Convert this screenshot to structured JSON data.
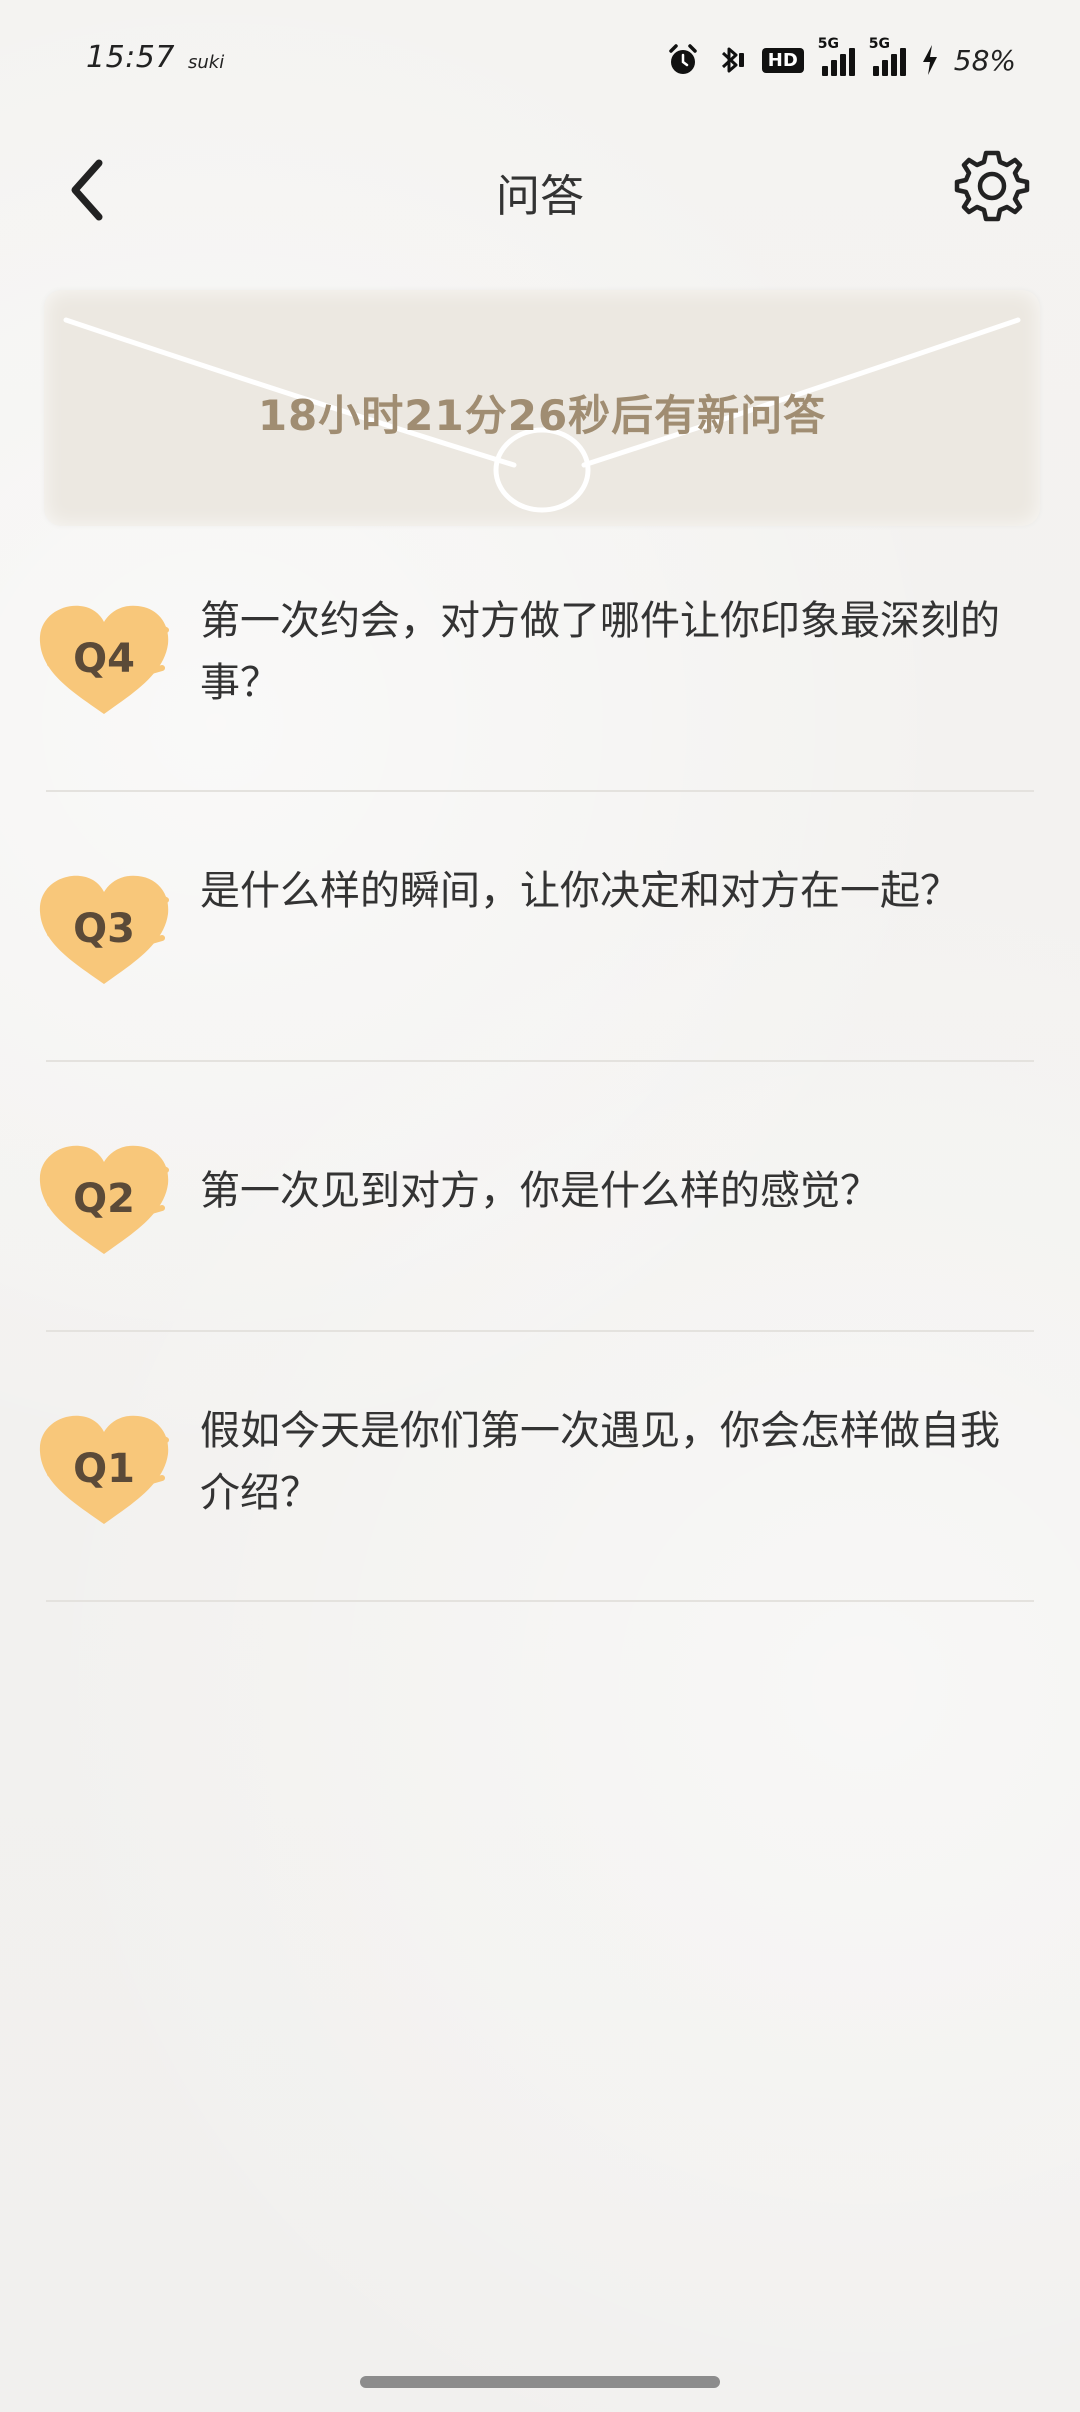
{
  "status_bar": {
    "time": "15:57",
    "carrier_note": "suki",
    "hd_label": "HD",
    "network1": "5G",
    "network2": "5G",
    "battery": "58%"
  },
  "header": {
    "title": "问答",
    "back_icon": "chevron-left-icon",
    "settings_icon": "gear-icon"
  },
  "envelope": {
    "countdown": "18小时21分26秒后有新问答"
  },
  "questions": [
    {
      "label": "Q4",
      "text": "第一次约会，对方做了哪件让你印象最深刻的事？"
    },
    {
      "label": "Q3",
      "text": "是什么样的瞬间，让你决定和对方在一起？"
    },
    {
      "label": "Q2",
      "text": "第一次见到对方，你是什么样的感觉？"
    },
    {
      "label": "Q1",
      "text": "假如今天是你们第一次遇见，你会怎样做自我介绍？"
    }
  ],
  "colors": {
    "badge": "#f8c77a",
    "countdown": "#a08d72",
    "envelope": "#ece8e1"
  }
}
